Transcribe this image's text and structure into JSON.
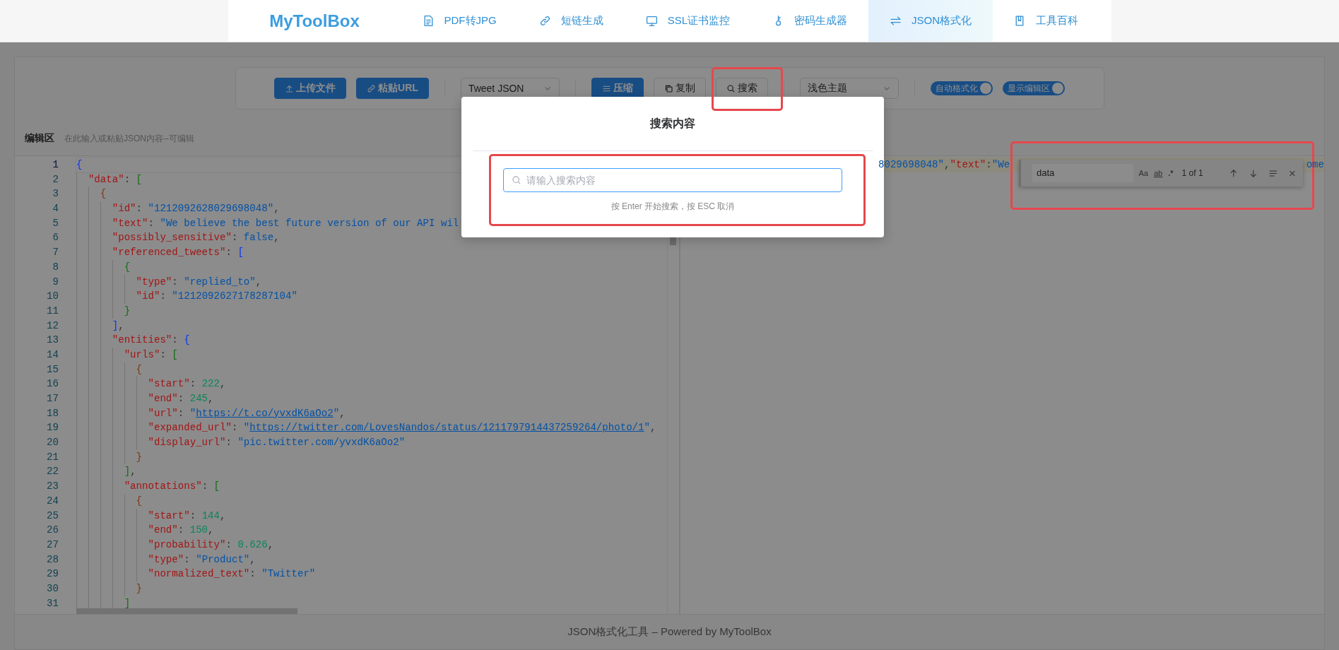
{
  "nav": {
    "logo": "MyToolBox",
    "items": [
      {
        "label": "PDF转JPG",
        "selected": false
      },
      {
        "label": "短链生成",
        "selected": false
      },
      {
        "label": "SSL证书监控",
        "selected": false
      },
      {
        "label": "密码生成器",
        "selected": false
      },
      {
        "label": "JSON格式化",
        "selected": true
      },
      {
        "label": "工具百科",
        "selected": false
      }
    ]
  },
  "toolbar": {
    "groups": [
      {
        "items": [
          {
            "kind": "primary",
            "label": "上传文件"
          },
          {
            "kind": "primary",
            "label": "粘贴URL"
          }
        ]
      },
      {
        "items": [
          {
            "kind": "select",
            "value": "Tweet JSON"
          }
        ]
      },
      {
        "items": [
          {
            "kind": "primary",
            "label": "压缩"
          },
          {
            "kind": "plain",
            "label": "复制"
          },
          {
            "kind": "plain",
            "label": "搜索"
          }
        ]
      },
      {
        "items": [
          {
            "kind": "select",
            "value": "浅色主题"
          }
        ]
      },
      {
        "items": [
          {
            "kind": "switch",
            "label": "自动格式化",
            "on": true
          },
          {
            "kind": "switch",
            "label": "显示编辑区",
            "on": true
          }
        ]
      }
    ]
  },
  "editor": {
    "title": "编辑区",
    "hint": "在此输入或粘贴JSON内容--可编辑",
    "lines": [
      {
        "number": "1",
        "current": true,
        "tokens": [
          {
            "kind": "bracket",
            "text": "{"
          }
        ]
      },
      {
        "number": "2",
        "current": false,
        "tokens": [
          {
            "kind": "key",
            "text": "  \"data\""
          },
          {
            "kind": "punct",
            "text": ": "
          },
          {
            "kind": "bracket",
            "text": "["
          }
        ]
      },
      {
        "number": "3",
        "current": false,
        "tokens": [
          {
            "kind": "bracket",
            "text": "    {"
          }
        ]
      },
      {
        "number": "4",
        "current": false,
        "tokens": [
          {
            "kind": "key",
            "text": "      \"id\""
          },
          {
            "kind": "punct",
            "text": ": "
          },
          {
            "kind": "string",
            "text": "\"1212092628029698048\""
          },
          {
            "kind": "punct",
            "text": ","
          }
        ]
      },
      {
        "number": "5",
        "current": false,
        "tokens": [
          {
            "kind": "key",
            "text": "      \"text\""
          },
          {
            "kind": "punct",
            "text": ": "
          },
          {
            "kind": "string",
            "text": "\"We believe the best future version of our API wil"
          }
        ]
      },
      {
        "number": "6",
        "current": false,
        "tokens": [
          {
            "kind": "key",
            "text": "      \"possibly_sensitive\""
          },
          {
            "kind": "punct",
            "text": ": "
          },
          {
            "kind": "keyword",
            "text": "false"
          },
          {
            "kind": "punct",
            "text": ","
          }
        ]
      },
      {
        "number": "7",
        "current": false,
        "tokens": [
          {
            "kind": "key",
            "text": "      \"referenced_tweets\""
          },
          {
            "kind": "punct",
            "text": ": "
          },
          {
            "kind": "bracket",
            "text": "["
          }
        ]
      },
      {
        "number": "8",
        "current": false,
        "tokens": [
          {
            "kind": "bracket",
            "text": "        {"
          }
        ]
      },
      {
        "number": "9",
        "current": false,
        "tokens": [
          {
            "kind": "key",
            "text": "          \"type\""
          },
          {
            "kind": "punct",
            "text": ": "
          },
          {
            "kind": "string",
            "text": "\"replied_to\""
          },
          {
            "kind": "punct",
            "text": ","
          }
        ]
      },
      {
        "number": "10",
        "current": false,
        "tokens": [
          {
            "kind": "key",
            "text": "          \"id\""
          },
          {
            "kind": "punct",
            "text": ": "
          },
          {
            "kind": "string",
            "text": "\"1212092627178287104\""
          }
        ]
      },
      {
        "number": "11",
        "current": false,
        "tokens": [
          {
            "kind": "bracket",
            "text": "        }"
          }
        ]
      },
      {
        "number": "12",
        "current": false,
        "tokens": [
          {
            "kind": "bracket",
            "text": "      ]"
          },
          {
            "kind": "punct",
            "text": ","
          }
        ]
      },
      {
        "number": "13",
        "current": false,
        "tokens": [
          {
            "kind": "key",
            "text": "      \"entities\""
          },
          {
            "kind": "punct",
            "text": ": "
          },
          {
            "kind": "bracket",
            "text": "{"
          }
        ]
      },
      {
        "number": "14",
        "current": false,
        "tokens": [
          {
            "kind": "key",
            "text": "        \"urls\""
          },
          {
            "kind": "punct",
            "text": ": "
          },
          {
            "kind": "bracket",
            "text": "["
          }
        ]
      },
      {
        "number": "15",
        "current": false,
        "tokens": [
          {
            "kind": "bracket",
            "text": "          {"
          }
        ]
      },
      {
        "number": "16",
        "current": false,
        "tokens": [
          {
            "kind": "key",
            "text": "            \"start\""
          },
          {
            "kind": "punct",
            "text": ": "
          },
          {
            "kind": "number",
            "text": "222"
          },
          {
            "kind": "punct",
            "text": ","
          }
        ]
      },
      {
        "number": "17",
        "current": false,
        "tokens": [
          {
            "kind": "key",
            "text": "            \"end\""
          },
          {
            "kind": "punct",
            "text": ": "
          },
          {
            "kind": "number",
            "text": "245"
          },
          {
            "kind": "punct",
            "text": ","
          }
        ]
      },
      {
        "number": "18",
        "current": false,
        "tokens": [
          {
            "kind": "key",
            "text": "            \"url\""
          },
          {
            "kind": "punct",
            "text": ": "
          },
          {
            "kind": "string",
            "text": "\""
          },
          {
            "kind": "link",
            "text": "https://t.co/yvxdK6aOo2"
          },
          {
            "kind": "string",
            "text": "\""
          },
          {
            "kind": "punct",
            "text": ","
          }
        ]
      },
      {
        "number": "19",
        "current": false,
        "tokens": [
          {
            "kind": "key",
            "text": "            \"expanded_url\""
          },
          {
            "kind": "punct",
            "text": ": "
          },
          {
            "kind": "string",
            "text": "\""
          },
          {
            "kind": "link",
            "text": "https://twitter.com/LovesNandos/status/1211797914437259264/photo/1"
          },
          {
            "kind": "string",
            "text": "\""
          },
          {
            "kind": "punct",
            "text": ","
          }
        ]
      },
      {
        "number": "20",
        "current": false,
        "tokens": [
          {
            "kind": "key",
            "text": "            \"display_url\""
          },
          {
            "kind": "punct",
            "text": ": "
          },
          {
            "kind": "string",
            "text": "\"pic.twitter.com/yvxdK6aOo2\""
          }
        ]
      },
      {
        "number": "21",
        "current": false,
        "tokens": [
          {
            "kind": "bracket",
            "text": "          }"
          }
        ]
      },
      {
        "number": "22",
        "current": false,
        "tokens": [
          {
            "kind": "bracket",
            "text": "        ]"
          },
          {
            "kind": "punct",
            "text": ","
          }
        ]
      },
      {
        "number": "23",
        "current": false,
        "tokens": [
          {
            "kind": "key",
            "text": "        \"annotations\""
          },
          {
            "kind": "punct",
            "text": ": "
          },
          {
            "kind": "bracket",
            "text": "["
          }
        ]
      },
      {
        "number": "24",
        "current": false,
        "tokens": [
          {
            "kind": "bracket",
            "text": "          {"
          }
        ]
      },
      {
        "number": "25",
        "current": false,
        "tokens": [
          {
            "kind": "key",
            "text": "            \"start\""
          },
          {
            "kind": "punct",
            "text": ": "
          },
          {
            "kind": "number",
            "text": "144"
          },
          {
            "kind": "punct",
            "text": ","
          }
        ]
      },
      {
        "number": "26",
        "current": false,
        "tokens": [
          {
            "kind": "key",
            "text": "            \"end\""
          },
          {
            "kind": "punct",
            "text": ": "
          },
          {
            "kind": "number",
            "text": "150"
          },
          {
            "kind": "punct",
            "text": ","
          }
        ]
      },
      {
        "number": "27",
        "current": false,
        "tokens": [
          {
            "kind": "key",
            "text": "            \"probability\""
          },
          {
            "kind": "punct",
            "text": ": "
          },
          {
            "kind": "number",
            "text": "0.626"
          },
          {
            "kind": "punct",
            "text": ","
          }
        ]
      },
      {
        "number": "28",
        "current": false,
        "tokens": [
          {
            "kind": "key",
            "text": "            \"type\""
          },
          {
            "kind": "punct",
            "text": ": "
          },
          {
            "kind": "string",
            "text": "\"Product\""
          },
          {
            "kind": "punct",
            "text": ","
          }
        ]
      },
      {
        "number": "29",
        "current": false,
        "tokens": [
          {
            "kind": "key",
            "text": "            \"normalized_text\""
          },
          {
            "kind": "punct",
            "text": ": "
          },
          {
            "kind": "string",
            "text": "\"Twitter\""
          }
        ]
      },
      {
        "number": "30",
        "current": false,
        "tokens": [
          {
            "kind": "bracket",
            "text": "          }"
          }
        ]
      },
      {
        "number": "31",
        "current": false,
        "tokens": [
          {
            "kind": "bracket",
            "text": "        ]"
          }
        ]
      }
    ]
  },
  "output": {
    "segments": [
      {
        "tokens": [
          {
            "kind": "string",
            "text": "8029698048\""
          },
          {
            "kind": "punct",
            "text": ","
          },
          {
            "kind": "key",
            "text": "\"text\""
          },
          {
            "kind": "punct",
            "text": ":"
          },
          {
            "kind": "string",
            "text": "\"We"
          }
        ]
      },
      {
        "tokens": [
          {
            "kind": "string",
            "text": "ome"
          }
        ]
      }
    ],
    "find_widget": {
      "query": "data",
      "options": [
        "Aa",
        "ab",
        ".*"
      ],
      "count": "1 of 1"
    }
  },
  "modal": {
    "title": "搜索内容",
    "placeholder": "请输入搜索内容",
    "hint": "按 Enter 开始搜索，按 ESC 取消"
  },
  "footer": {
    "text": "JSON格式化工具 – Powered by MyToolBox"
  }
}
